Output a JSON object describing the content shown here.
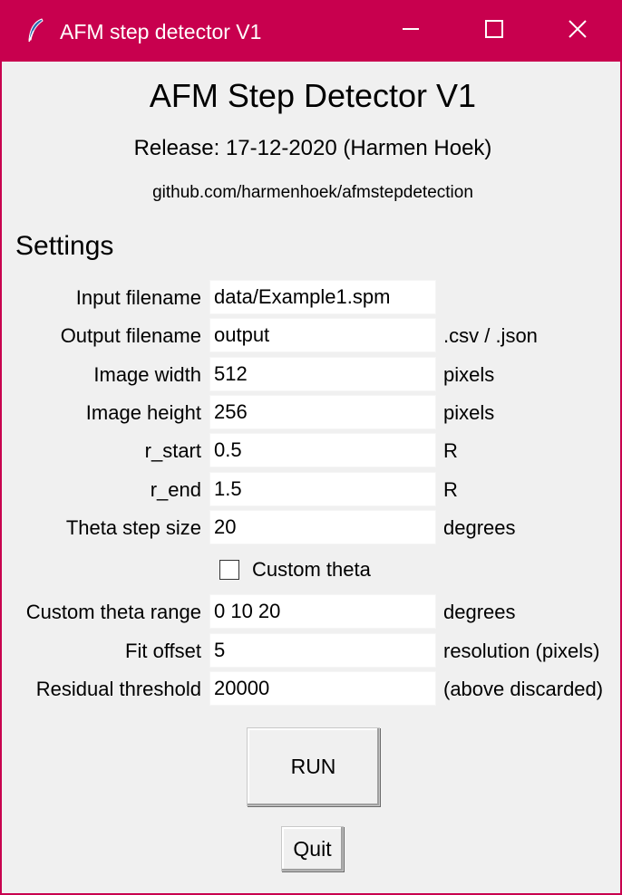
{
  "window": {
    "title": "AFM step detector V1",
    "icon": "feather-icon",
    "controls": [
      "minimize-icon",
      "maximize-icon",
      "close-icon"
    ],
    "accent_color": "#c8004e"
  },
  "header": {
    "title": "AFM Step Detector V1",
    "release": "Release: 17-12-2020 (Harmen Hoek)",
    "url": "github.com/harmenhoek/afmstepdetection"
  },
  "settings": {
    "heading": "Settings",
    "fields": [
      {
        "label": "Input filename",
        "value": "data/Example1.spm",
        "unit": ""
      },
      {
        "label": "Output filename",
        "value": "output",
        "unit": ".csv / .json"
      },
      {
        "label": "Image width",
        "value": "512",
        "unit": "pixels"
      },
      {
        "label": "Image height",
        "value": "256",
        "unit": "pixels"
      },
      {
        "label": "r_start",
        "value": "0.5",
        "unit": "R"
      },
      {
        "label": "r_end",
        "value": "1.5",
        "unit": "R"
      },
      {
        "label": "Theta step size",
        "value": "20",
        "unit": "degrees"
      }
    ],
    "custom_theta": {
      "label": "Custom theta",
      "checked": false
    },
    "extra_fields": [
      {
        "label": "Custom theta range",
        "value": "0 10 20",
        "unit": "degrees"
      },
      {
        "label": "Fit offset",
        "value": "5",
        "unit": "resolution (pixels)"
      },
      {
        "label": "Residual threshold",
        "value": "20000",
        "unit": "(above discarded)"
      }
    ]
  },
  "actions": {
    "run_label": "RUN",
    "quit_label": "Quit"
  }
}
